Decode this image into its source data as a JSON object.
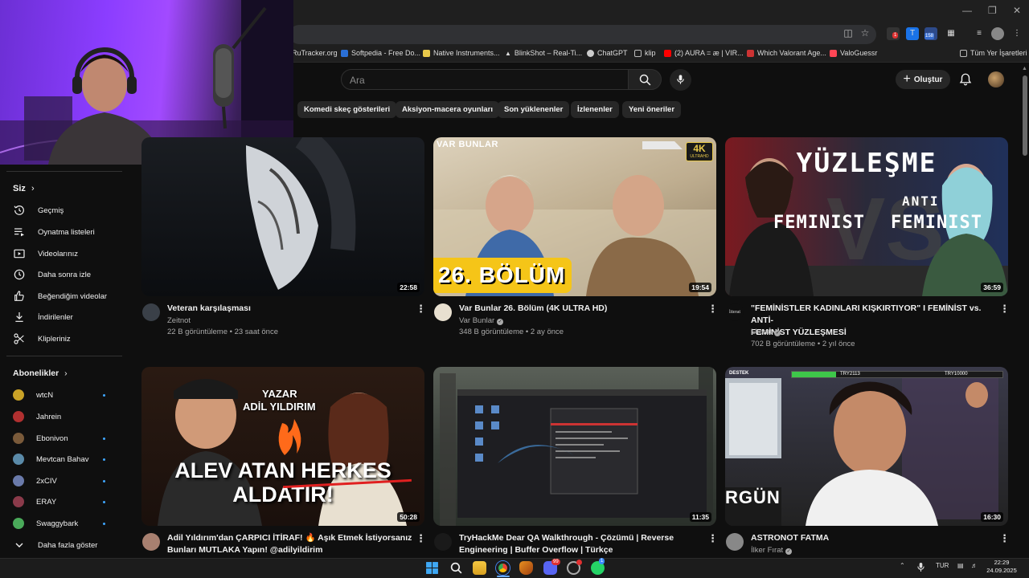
{
  "browser": {
    "bookmarks": [
      {
        "label": "RuTracker.org",
        "color": "#4a80c8"
      },
      {
        "label": "Softpedia - Free Do...",
        "color": "#2a6fd6"
      },
      {
        "label": "Native Instruments...",
        "color": "#e8c84a"
      },
      {
        "label": "BlinkShot – Real-Ti...",
        "color": "#e0e0e0"
      },
      {
        "label": "ChatGPT",
        "color": "#d0d0d0"
      },
      {
        "label": "klip",
        "color": "#bbbbbb"
      },
      {
        "label": "(2) AURA = æ | VIR...",
        "color": "#ff0000"
      },
      {
        "label": "Which Valorant Age...",
        "color": "#cc3333"
      },
      {
        "label": "ValoGuessr",
        "color": "#ff4655"
      }
    ],
    "all_bookmarks": "Tüm Yer İşaretleri",
    "ext_badge_1": "1",
    "ext_badge_2": "158"
  },
  "youtube": {
    "search_placeholder": "Ara",
    "create_label": "Oluştur",
    "chips": [
      "Komedi skeç gösterileri",
      "Aksiyon-macera oyunları",
      "Son yüklenenler",
      "İzlenenler",
      "Yeni öneriler"
    ],
    "sidebar": {
      "you_label": "Siz",
      "you_items": [
        "Geçmiş",
        "Oynatma listeleri",
        "Videolarınız",
        "Daha sonra izle",
        "Beğendiğim videolar",
        "İndirilenler",
        "Klipleriniz"
      ],
      "subs_label": "Abonelikler",
      "subscriptions": [
        {
          "name": "wtcN",
          "color": "#c9a227"
        },
        {
          "name": "Jahrein",
          "color": "#b03030"
        },
        {
          "name": "Ebonivon",
          "color": "#7a5a3a"
        },
        {
          "name": "Mevtcan Bahav",
          "color": "#5a8aa8"
        },
        {
          "name": "2xCIV",
          "color": "#6a7aaa"
        },
        {
          "name": "ERAY",
          "color": "#8a3a4a"
        },
        {
          "name": "Swaggybark",
          "color": "#4aaa5a"
        }
      ],
      "show_more": "Daha fazla göster"
    },
    "videos": [
      {
        "title": [
          "Veteran karşılaşması"
        ],
        "channel": "Zeitnot",
        "verified": false,
        "meta": "22 B görüntüleme • 23 saat önce",
        "duration": "22:58"
      },
      {
        "title": [
          "Var Bunlar 26. Bölüm (4K ULTRA HD)"
        ],
        "channel": "Var Bunlar",
        "verified": true,
        "meta": "348 B görüntüleme • 2 ay önce",
        "duration": "19:54",
        "thumb_top_label": "VAR BUNLAR",
        "thumb_badge": "4K",
        "thumb_badge_sub": "ULTRAHD",
        "thumb_bottom_label": "26. BÖLÜM"
      },
      {
        "title": [
          "\"FEMİNİSTLER KADINLARI KIŞKIRTIYOR\" I FEMİNİST vs. ANTİ-",
          "FEMİNİST YÜZLEŞMESİ"
        ],
        "channel": "Literat",
        "verified": true,
        "meta": "702 B görüntüleme • 2 yıl önce",
        "duration": "36:59",
        "thumb_heading": "YÜZLEŞME",
        "thumb_anti": "ANTI",
        "thumb_left": "FEMINIST",
        "thumb_right": "FEMINIST",
        "thumb_vs": "VS"
      },
      {
        "title": [
          "Adil Yıldırım'dan ÇARPICI İTİRAF! 🔥 Aşık Etmek İstiyorsanız",
          "Bunları MUTLAKA Yapın! @adilyildirim"
        ],
        "channel": "",
        "verified": false,
        "meta": "",
        "duration": "50:28",
        "thumb_small1": "YAZAR",
        "thumb_small2": "ADİL YILDIRIM",
        "thumb_big1": "ALEV ATAN HERKES",
        "thumb_big2": "ALDATIR!"
      },
      {
        "title": [
          "TryHackMe Dear QA Walkthrough - Çözümü | Reverse",
          "Engineering | Buffer Overflow | Türkçe"
        ],
        "channel": "",
        "verified": false,
        "meta": "",
        "duration": "11:35"
      },
      {
        "title": [
          "ASTRONOT FATMA"
        ],
        "channel": "İlker Fırat",
        "verified": true,
        "meta": "",
        "duration": "16:30",
        "thumb_bar_label": "DESTEK",
        "thumb_bar_val1": "TRY2113",
        "thumb_bar_val2": "TRY10000",
        "thumb_side": "RGÜN"
      }
    ]
  },
  "taskbar": {
    "lang": "TUR",
    "time": "22:29",
    "date": "24.09.2025",
    "discord_badge": "99",
    "whatsapp_badge": "1"
  }
}
